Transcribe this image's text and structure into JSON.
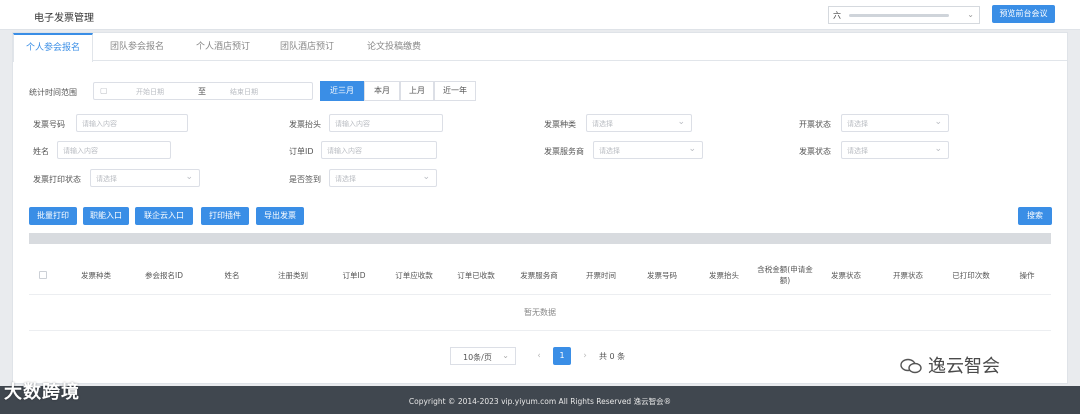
{
  "header": {
    "title": "电子发票管理",
    "selector_value": "六",
    "preview_button": "预览前台会议"
  },
  "tabs": [
    {
      "label": "个人参会报名",
      "active": true
    },
    {
      "label": "团队参会报名",
      "active": false
    },
    {
      "label": "个人酒店预订",
      "active": false
    },
    {
      "label": "团队酒店预订",
      "active": false
    },
    {
      "label": "论文投稿缴费",
      "active": false
    }
  ],
  "filters": {
    "date_range": {
      "label": "统计时间范围",
      "start_placeholder": "开始日期",
      "separator": "至",
      "end_placeholder": "结束日期"
    },
    "quick_ranges": [
      "近三月",
      "本月",
      "上月",
      "近一年"
    ],
    "invoice_number": {
      "label": "发票号码",
      "placeholder": "请输入内容"
    },
    "invoice_header": {
      "label": "发票抬头",
      "placeholder": "请输入内容"
    },
    "invoice_type": {
      "label": "发票种类",
      "placeholder": "请选择"
    },
    "issue_status": {
      "label": "开票状态",
      "placeholder": "请选择"
    },
    "name": {
      "label": "姓名",
      "placeholder": "请输入内容"
    },
    "order_id": {
      "label": "订单ID",
      "placeholder": "请输入内容"
    },
    "service_provider": {
      "label": "发票服务商",
      "placeholder": "请选择"
    },
    "invoice_status": {
      "label": "发票状态",
      "placeholder": "请选择"
    },
    "print_status": {
      "label": "发票打印状态",
      "placeholder": "请选择"
    },
    "checked_in": {
      "label": "是否签到",
      "placeholder": "请选择"
    }
  },
  "actions": {
    "batch_print": "批量打印",
    "staff_entry": "职能入口",
    "remote_entry": "联企云入口",
    "print_plugin": "打印插件",
    "export": "导出发票",
    "search": "搜索"
  },
  "table": {
    "columns": [
      "发票种类",
      "参会报名ID",
      "姓名",
      "注册类别",
      "订单ID",
      "订单应收款",
      "订单已收款",
      "发票服务商",
      "开票时间",
      "发票号码",
      "发票抬头",
      "含税金额(申请金额)",
      "发票状态",
      "开票状态",
      "已打印次数",
      "操作"
    ],
    "empty_text": "暂无数据"
  },
  "pagination": {
    "page_size": "10条/页",
    "current_page": "1",
    "total": "共 0 条",
    "prev": "‹",
    "next": "›"
  },
  "footer": {
    "copyright": "Copyright © 2014-2023 vip.yiyum.com All Rights Reserved  逸云智会®"
  },
  "watermarks": {
    "left": "大数跨境",
    "right": "逸云智会"
  }
}
